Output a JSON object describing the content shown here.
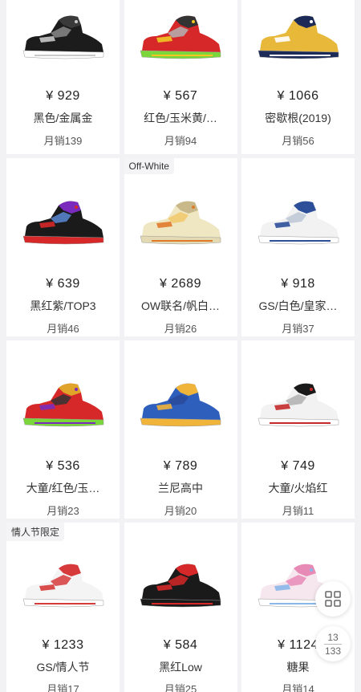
{
  "products": [
    {
      "price": "¥ 929",
      "name": "黑色/金属金",
      "sales": "月销139",
      "tag": "",
      "colors": {
        "upper": "#1c1c1c",
        "accent": "#3a3a3a",
        "sole": "#ffffff",
        "mid": "#888888",
        "trim": "#c9c9c9"
      }
    },
    {
      "price": "¥ 567",
      "name": "红色/玉米黄/…",
      "sales": "月销94",
      "tag": "",
      "colors": {
        "upper": "#d62828",
        "accent": "#333333",
        "sole": "#7ad63a",
        "mid": "#b3b3b3",
        "trim": "#f3c623"
      }
    },
    {
      "price": "¥ 1066",
      "name": "密歇根(2019)",
      "sales": "月销56",
      "tag": "",
      "colors": {
        "upper": "#e8b83a",
        "accent": "#1c2a58",
        "sole": "#1c2a58",
        "mid": "#e8b83a",
        "trim": "#ffffff"
      }
    },
    {
      "price": "¥ 639",
      "name": "黑红紫/TOP3",
      "sales": "月销46",
      "tag": "",
      "colors": {
        "upper": "#1a1a1a",
        "accent": "#7a2bbd",
        "sole": "#d62828",
        "mid": "#5a8ad6",
        "trim": "#d62828"
      }
    },
    {
      "price": "¥ 2689",
      "name": "OW联名/帆白…",
      "sales": "月销26",
      "tag": "Off-White",
      "colors": {
        "upper": "#efe6c2",
        "accent": "#c9b98a",
        "sole": "#e3d9b3",
        "mid": "#f2c86b",
        "trim": "#e07a2b"
      }
    },
    {
      "price": "¥ 918",
      "name": "GS/白色/皇家…",
      "sales": "月销37",
      "tag": "",
      "colors": {
        "upper": "#f2f2f2",
        "accent": "#2d4f9a",
        "sole": "#ffffff",
        "mid": "#bdc6d6",
        "trim": "#2d4f9a"
      }
    },
    {
      "price": "¥ 536",
      "name": "大童/红色/玉…",
      "sales": "月销23",
      "tag": "",
      "colors": {
        "upper": "#d62828",
        "accent": "#e0a42a",
        "sole": "#7ad63a",
        "mid": "#333333",
        "trim": "#7a2bbd"
      }
    },
    {
      "price": "¥ 789",
      "name": "兰尼高中",
      "sales": "月销20",
      "tag": "",
      "colors": {
        "upper": "#2f5fbd",
        "accent": "#f0b43a",
        "sole": "#f0b43a",
        "mid": "#2a4a9a",
        "trim": "#f0b43a"
      }
    },
    {
      "price": "¥ 749",
      "name": "大童/火焰红",
      "sales": "月销11",
      "tag": "",
      "colors": {
        "upper": "#f2f2f2",
        "accent": "#1a1a1a",
        "sole": "#ffffff",
        "mid": "#b0b0b0",
        "trim": "#c42a2a"
      }
    },
    {
      "price": "¥ 1233",
      "name": "GS/情人节",
      "sales": "月销17",
      "tag": "情人节限定",
      "colors": {
        "upper": "#f4f4f4",
        "accent": "#d63a3a",
        "sole": "#ffffff",
        "mid": "#d63a3a",
        "trim": "#d63a3a"
      }
    },
    {
      "price": "¥ 584",
      "name": "黑红Low",
      "sales": "月销25",
      "tag": "",
      "colors": {
        "upper": "#1a1a1a",
        "accent": "#d62828",
        "sole": "#1a1a1a",
        "mid": "#d62828",
        "trim": "#d62828"
      }
    },
    {
      "price": "¥ 1124",
      "name": "糖果",
      "sales": "月销14",
      "tag": "",
      "colors": {
        "upper": "#f6e6ee",
        "accent": "#e88ab6",
        "sole": "#ffffff",
        "mid": "#e88ab6",
        "trim": "#8ab6e8"
      }
    }
  ],
  "floating": {
    "grid_icon": "grid-view-icon",
    "page_current": "13",
    "page_total": "133"
  }
}
